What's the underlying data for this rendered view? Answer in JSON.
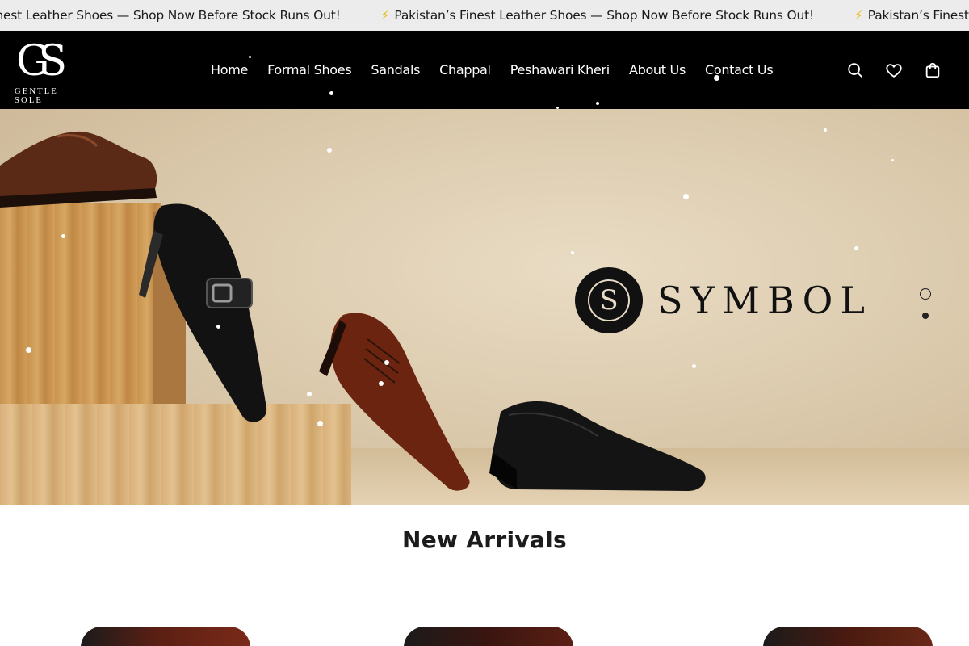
{
  "ticker": {
    "items": [
      "Pakistan’s Finest Leather Shoes — Shop Now Before Stock Runs Out!",
      "Pakistan’s Finest Leather Shoes — Shop Now Before Stock Runs Out!",
      "Pakistan’s Finest Leather Shoes — Shop Now Before Stock Runs Out!"
    ],
    "icon": "lightning-icon"
  },
  "header": {
    "logo_mark": "GS",
    "logo_text": "GENTLE SOLE",
    "nav": [
      "Home",
      "Formal Shoes",
      "Sandals",
      "Chappal",
      "Peshawari Kheri",
      "About Us",
      "Contact Us"
    ],
    "icons": [
      "search-icon",
      "heart-icon",
      "shopping-bag-icon"
    ]
  },
  "hero": {
    "brand_initial": "S",
    "brand_word": "SYMBOL",
    "slides": 2,
    "active_slide": 1
  },
  "new_arrivals": {
    "title": "New Arrivals"
  },
  "colors": {
    "header_bg": "#000000",
    "ticker_bg": "#ececec",
    "accent_bolt": "#e6b400",
    "hero_bg": "#d9c7a9"
  }
}
